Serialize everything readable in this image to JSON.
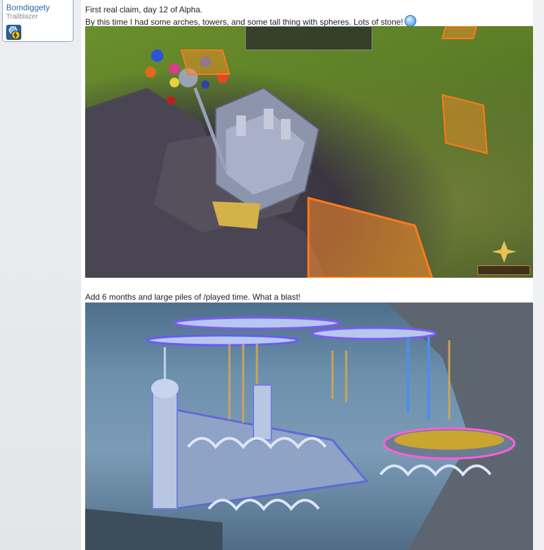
{
  "author": {
    "name": "Bomdiggety",
    "title": "Trailblazer",
    "badge_icon": "rank-badge-icon"
  },
  "post": {
    "line1": "First real claim, day 12 of Alpha.",
    "line2": "By this time I had some arches, towers, and some tall thing with spheres. Lots of stone!",
    "smiley_icon": "smiley-icon",
    "line3": "Add 6 months and large piles of /played time. What a blast!"
  },
  "images": {
    "first": "first-claim-screenshot",
    "second": "six-months-later-screenshot"
  },
  "colors": {
    "author_name": "#2f6aa8",
    "card_border": "#8aa6c6"
  }
}
